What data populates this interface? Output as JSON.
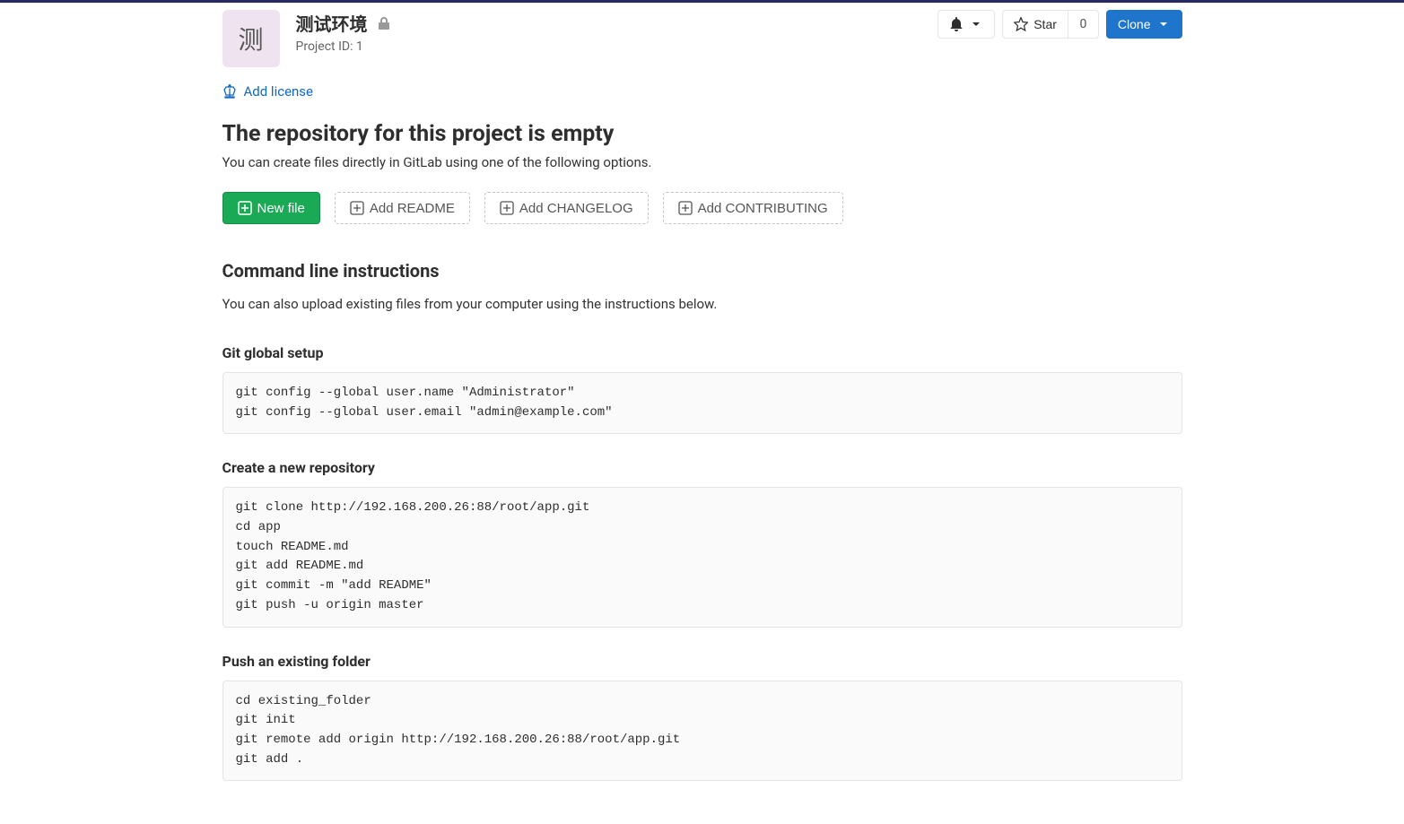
{
  "avatar_letter": "测",
  "project": {
    "name": "测试环境",
    "id_label": "Project ID: 1"
  },
  "actions": {
    "star_label": "Star",
    "star_count": "0",
    "clone_label": "Clone"
  },
  "license": {
    "label": "Add license"
  },
  "empty": {
    "heading": "The repository for this project is empty",
    "subtext": "You can create files directly in GitLab using one of the following options."
  },
  "buttons": {
    "new_file": "New file",
    "add_readme": "Add README",
    "add_changelog": "Add CHANGELOG",
    "add_contributing": "Add CONTRIBUTING"
  },
  "cli": {
    "heading": "Command line instructions",
    "subtext": "You can also upload existing files from your computer using the instructions below."
  },
  "sections": {
    "global_setup": {
      "title": "Git global setup",
      "code": "git config --global user.name \"Administrator\"\ngit config --global user.email \"admin@example.com\""
    },
    "create_repo": {
      "title": "Create a new repository",
      "code": "git clone http://192.168.200.26:88/root/app.git\ncd app\ntouch README.md\ngit add README.md\ngit commit -m \"add README\"\ngit push -u origin master"
    },
    "push_folder": {
      "title": "Push an existing folder",
      "code": "cd existing_folder\ngit init\ngit remote add origin http://192.168.200.26:88/root/app.git\ngit add ."
    }
  }
}
